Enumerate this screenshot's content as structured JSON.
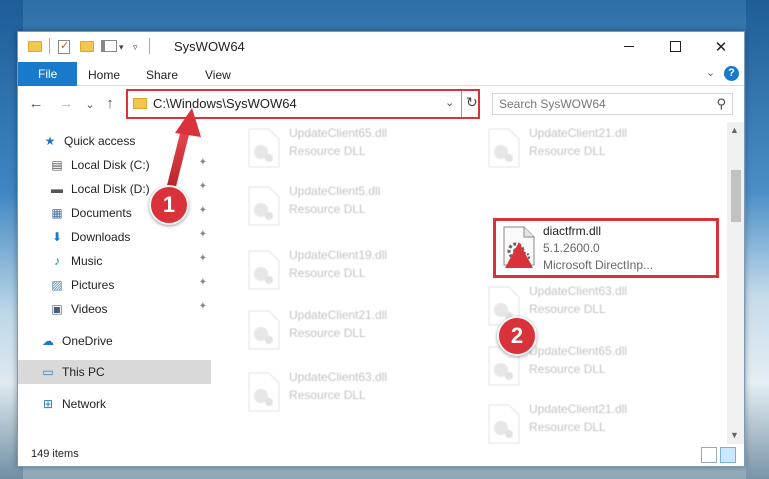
{
  "window": {
    "title": "SysWOW64",
    "controls": {
      "minimize": "",
      "maximize": "",
      "close": "✕"
    }
  },
  "ribbon": {
    "tabs": [
      "File",
      "Home",
      "Share",
      "View"
    ],
    "expand_chevron": "⌄",
    "help": "?"
  },
  "nav": {
    "back": "←",
    "forward": "→",
    "recent": "⌄",
    "up": "↑",
    "address": "C:\\Windows\\SysWOW64",
    "dropdown": "⌄",
    "refresh": "↻",
    "search_placeholder": "Search SysWOW64",
    "search_glyph": "⚲"
  },
  "sidebar": {
    "items": [
      {
        "label": "Quick access",
        "icon": "★",
        "icon_name": "star-icon",
        "pinned": false,
        "color": "#1979ca"
      },
      {
        "label": "Local Disk (C:)",
        "icon": "▤",
        "icon_name": "drive-icon",
        "pinned": true,
        "color": "#555"
      },
      {
        "label": "Local Disk (D:)",
        "icon": "▬",
        "icon_name": "drive-icon",
        "pinned": true,
        "color": "#555"
      },
      {
        "label": "Documents",
        "icon": "▦",
        "icon_name": "documents-icon",
        "pinned": true,
        "color": "#4a6f9e"
      },
      {
        "label": "Downloads",
        "icon": "⬇",
        "icon_name": "downloads-icon",
        "pinned": true,
        "color": "#1979ca"
      },
      {
        "label": "Music",
        "icon": "♪",
        "icon_name": "music-icon",
        "pinned": true,
        "color": "#1979ca"
      },
      {
        "label": "Pictures",
        "icon": "▨",
        "icon_name": "pictures-icon",
        "pinned": true,
        "color": "#4a7fb5"
      },
      {
        "label": "Videos",
        "icon": "▣",
        "icon_name": "videos-icon",
        "pinned": true,
        "color": "#4a5a7a"
      },
      {
        "label": "OneDrive",
        "icon": "☁",
        "icon_name": "onedrive-icon",
        "pinned": false,
        "color": "#1979ca"
      },
      {
        "label": "This PC",
        "icon": "▭",
        "icon_name": "computer-icon",
        "pinned": false,
        "color": "#2a7fc0"
      },
      {
        "label": "Network",
        "icon": "⊞",
        "icon_name": "network-icon",
        "pinned": false,
        "color": "#2a7fc0"
      }
    ],
    "pin_glyph": "📌"
  },
  "files": {
    "left": [
      {
        "name": "UpdateClient65.dll",
        "type": "Resource DLL"
      },
      {
        "name": "UpdateClient5.dll",
        "type": "Resource DLL"
      },
      {
        "name": "UpdateClient19.dll",
        "type": "Resource DLL"
      },
      {
        "name": "UpdateClient21.dll",
        "type": "Resource DLL"
      },
      {
        "name": "UpdateClient63.dll",
        "type": "Resource DLL"
      }
    ],
    "right": [
      {
        "name": "UpdateClient21.dll",
        "type": "Resource DLL"
      },
      {
        "name": "UpdateClient63.dll",
        "type": "Resource DLL"
      },
      {
        "name": "UpdateClient65.dll",
        "type": "Resource DLL"
      },
      {
        "name": "UpdateClient21.dll",
        "type": "Resource DLL"
      }
    ],
    "highlighted": {
      "name": "diactfrm.dll",
      "version": "5.1.2600.0",
      "description": "Microsoft DirectInp..."
    }
  },
  "status": {
    "item_count": "149 items"
  },
  "annotations": {
    "badge1": "1",
    "badge2": "2"
  },
  "colors": {
    "accent": "#1979ca",
    "highlight": "#d9323a"
  }
}
